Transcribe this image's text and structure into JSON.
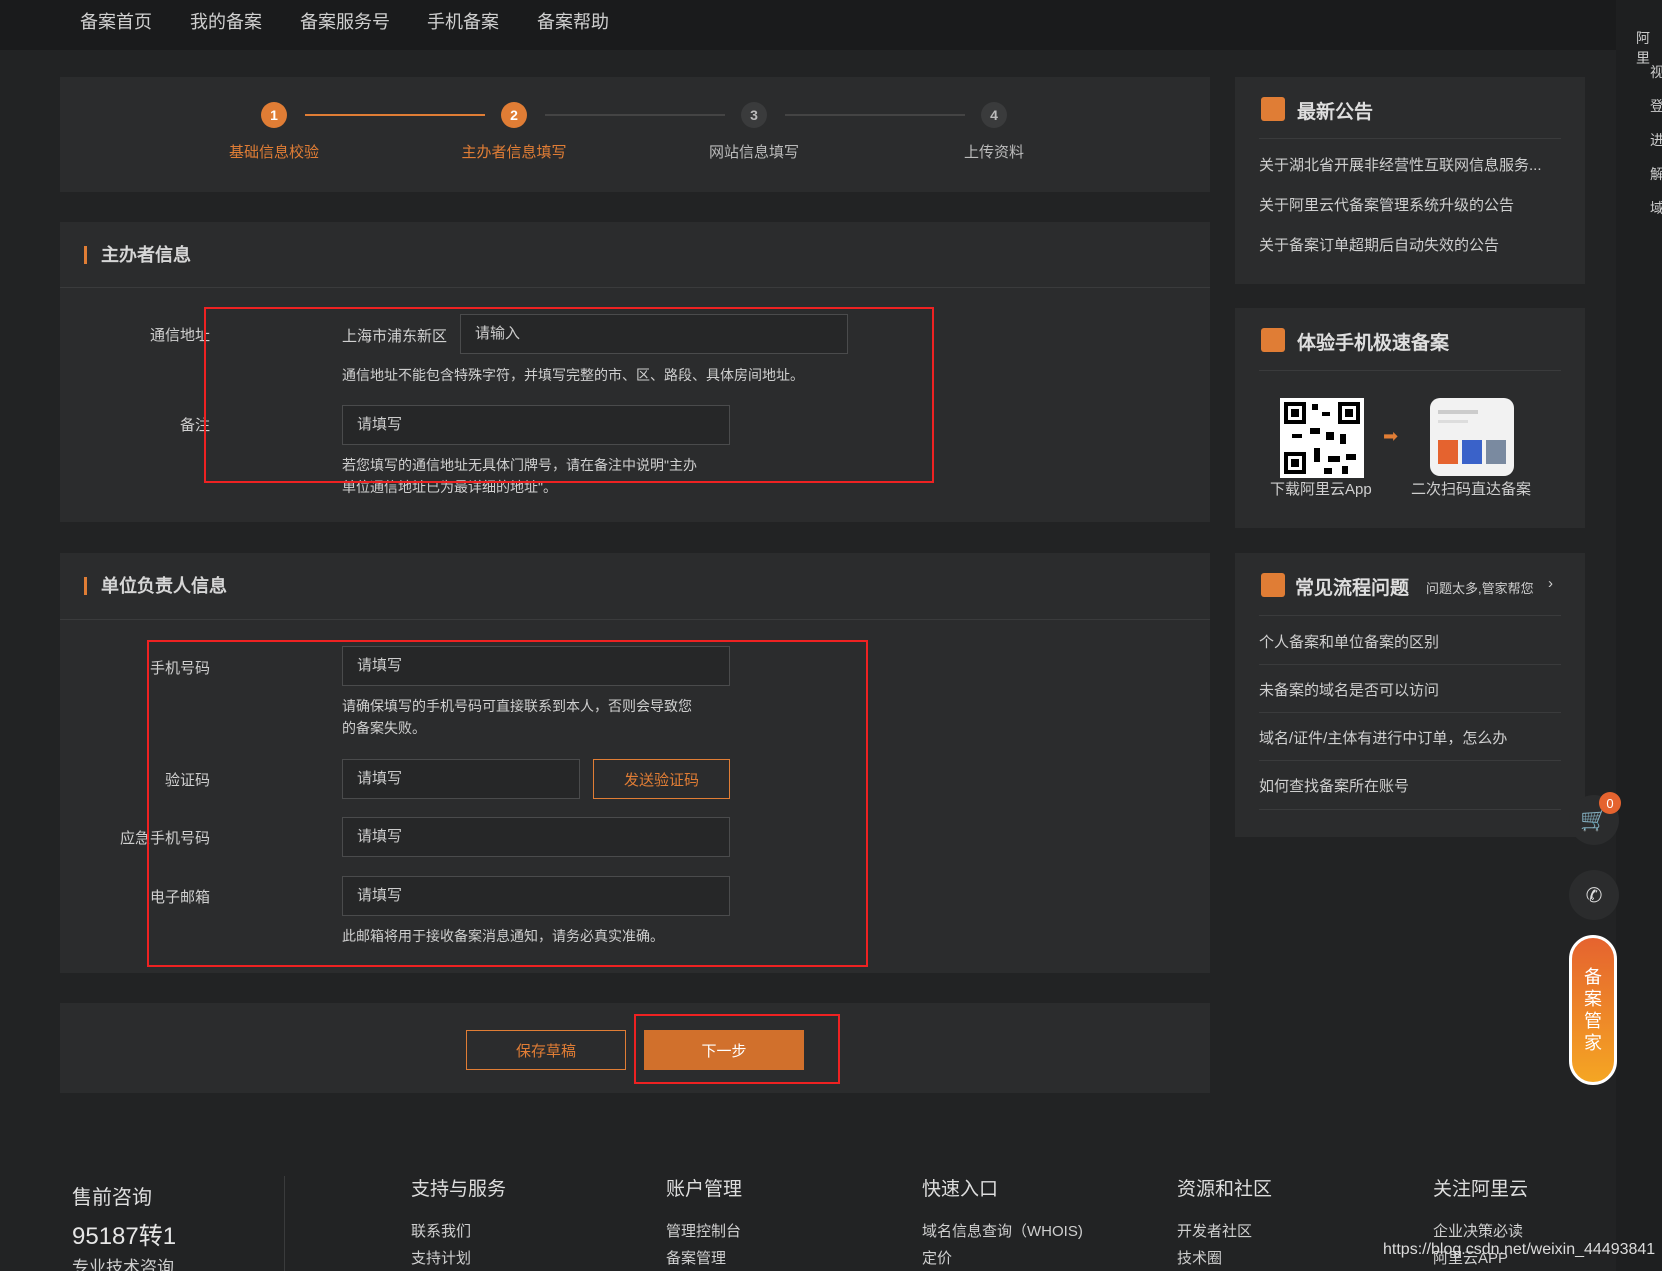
{
  "nav": {
    "items": [
      "备案首页",
      "我的备案",
      "备案服务号",
      "手机备案",
      "备案帮助"
    ]
  },
  "steps": [
    {
      "num": "1",
      "label": "基础信息校验",
      "state": "done"
    },
    {
      "num": "2",
      "label": "主办者信息填写",
      "state": "active"
    },
    {
      "num": "3",
      "label": "网站信息填写",
      "state": "todo"
    },
    {
      "num": "4",
      "label": "上传资料",
      "state": "todo"
    }
  ],
  "sponsor": {
    "title": "主办者信息",
    "address_label": "通信地址",
    "address_region": "上海市浦东新区",
    "address_placeholder": "请输入",
    "address_hint": "通信地址不能包含特殊字符，并填写完整的市、区、路段、具体房间地址。",
    "remark_label": "备注",
    "remark_placeholder": "请填写",
    "remark_hint1": "若您填写的通信地址无具体门牌号，请在备注中说明\"主办",
    "remark_hint2": "单位通信地址已为最详细的地址\"。"
  },
  "person": {
    "title": "单位负责人信息",
    "phone_label": "手机号码",
    "phone_placeholder": "请填写",
    "phone_hint1": "请确保填写的手机号码可直接联系到本人，否则会导致您",
    "phone_hint2": "的备案失败。",
    "code_label": "验证码",
    "code_placeholder": "请填写",
    "send_code": "发送验证码",
    "emergency_label": "应急手机号码",
    "emergency_placeholder": "请填写",
    "email_label": "电子邮箱",
    "email_placeholder": "请填写",
    "email_hint": "此邮箱将用于接收备案消息通知，请务必真实准确。"
  },
  "actions": {
    "save": "保存草稿",
    "next": "下一步"
  },
  "sidebar": {
    "notice": {
      "title": "最新公告",
      "links": [
        "关于湖北省开展非经营性互联网信息服务...",
        "关于阿里云代备案管理系统升级的公告",
        "关于备案订单超期后自动失效的公告"
      ]
    },
    "mobile": {
      "title": "体验手机极速备案",
      "caption1": "下载阿里云App",
      "caption2": "二次扫码直达备案"
    },
    "faq": {
      "title": "常见流程问题",
      "more": "问题太多,管家帮您",
      "links": [
        "个人备案和单位备案的区别",
        "未备案的域名是否可以访问",
        "域名/证件/主体有进行中订单，怎么办",
        "如何查找备案所在账号"
      ]
    }
  },
  "float": {
    "cart_count": "0",
    "assistant": [
      "备",
      "案",
      "管",
      "家"
    ]
  },
  "rightstrip": [
    "阿里",
    "视",
    "登",
    "进",
    "解",
    "域"
  ],
  "footer": {
    "consult_title": "售前咨询",
    "phone": "95187转1",
    "consult_sub": "专业技术咨询",
    "cols": [
      {
        "head": "支持与服务",
        "links": [
          "联系我们",
          "支持计划"
        ]
      },
      {
        "head": "账户管理",
        "links": [
          "管理控制台",
          "备案管理"
        ]
      },
      {
        "head": "快速入口",
        "links": [
          "域名信息查询（WHOIS)",
          "定价"
        ]
      },
      {
        "head": "资源和社区",
        "links": [
          "开发者社区",
          "技术圈"
        ]
      },
      {
        "head": "关注阿里云",
        "links": [
          "企业决策必读",
          "阿里云APP"
        ]
      }
    ],
    "watermark": "https://blog.csdn.net/weixin_44493841"
  },
  "colors": {
    "accent": "#e07d35",
    "highlight": "#e22222",
    "bg": "#222324",
    "panel": "#2b2c2d"
  }
}
